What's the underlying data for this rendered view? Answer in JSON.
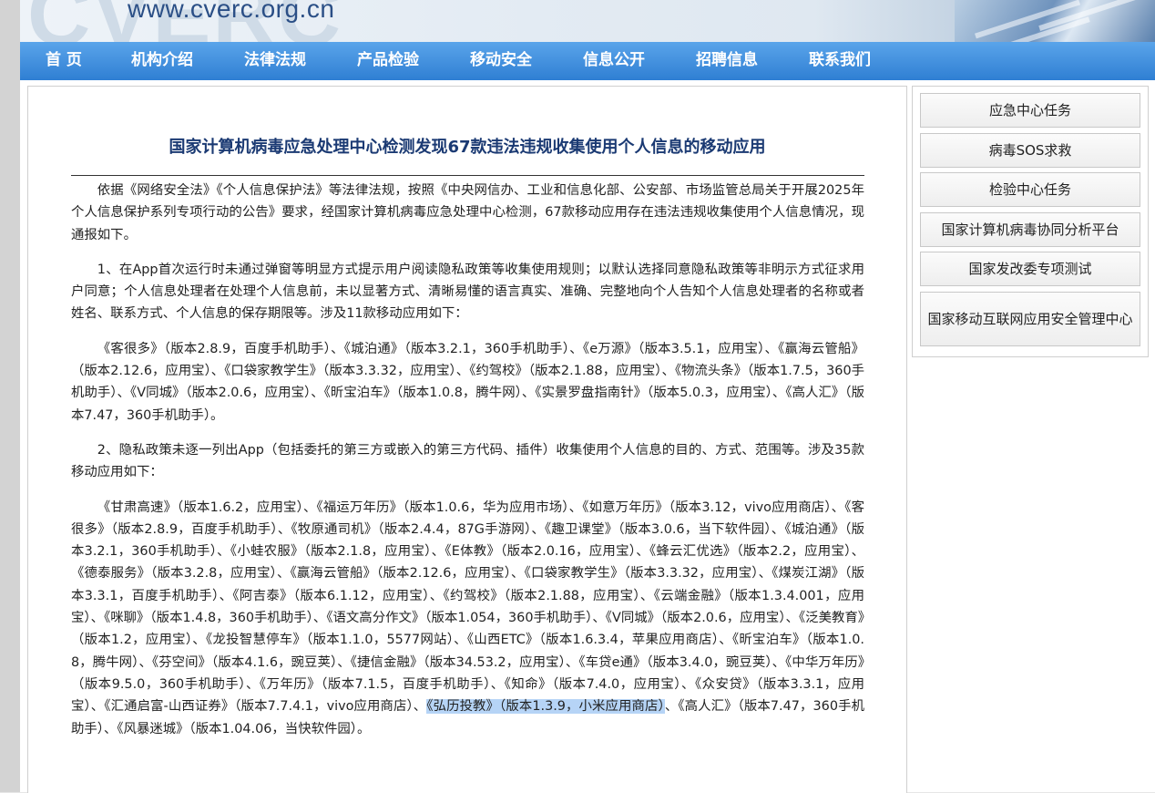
{
  "site": {
    "url": "www.cverc.org.cn",
    "banner_deco": "CVERC"
  },
  "nav": [
    "首 页",
    "机构介绍",
    "法律法规",
    "产品检验",
    "移动安全",
    "信息公开",
    "招聘信息",
    "联系我们"
  ],
  "article": {
    "title": "国家计算机病毒应急处理中心检测发现67款违法违规收集使用个人信息的移动应用",
    "paragraphs": [
      "依据《网络安全法》《个人信息保护法》等法律法规，按照《中央网信办、工业和信息化部、公安部、市场监管总局关于开展2025年个人信息保护系列专项行动的公告》要求，经国家计算机病毒应急处理中心检测，67款移动应用存在违法违规收集使用个人信息情况，现通报如下。",
      "1、在App首次运行时未通过弹窗等明显方式提示用户阅读隐私政策等收集使用规则；以默认选择同意隐私政策等非明示方式征求用户同意；个人信息处理者在处理个人信息前，未以显著方式、清晰易懂的语言真实、准确、完整地向个人告知个人信息处理者的名称或者姓名、联系方式、个人信息的保存期限等。涉及11款移动应用如下：",
      "《客很多》（版本2.8.9，百度手机助手）、《城泊通》（版本3.2.1，360手机助手）、《e万源》（版本3.5.1，应用宝）、《赢海云管船》（版本2.12.6，应用宝）、《口袋家教学生》（版本3.3.32，应用宝）、《约驾校》（版本2.1.88，应用宝）、《物流头条》（版本1.7.5，360手机助手）、《V同城》（版本2.0.6，应用宝）、《昕宝泊车》（版本1.0.8，腾牛网）、《实景罗盘指南针》（版本5.0.3，应用宝）、《高人汇》（版本7.47，360手机助手）。",
      "2、隐私政策未逐一列出App（包括委托的第三方或嵌入的第三方代码、插件）收集使用个人信息的目的、方式、范围等。涉及35款移动应用如下："
    ],
    "p5_before": "《甘肃高速》（版本1.6.2，应用宝）、《福运万年历》（版本1.0.6，华为应用市场）、《如意万年历》（版本3.12，vivo应用商店）、《客很多》（版本2.8.9，百度手机助手）、《牧原通司机》（版本2.4.4，87G手游网）、《趣卫课堂》（版本3.0.6，当下软件园）、《城泊通》（版本3.2.1，360手机助手）、《小蛙农服》（版本2.1.8，应用宝）、《E体教》（版本2.0.16，应用宝）、《蜂云汇优选》（版本2.2，应用宝）、《德泰服务》（版本3.2.8，应用宝）、《赢海云管船》（版本2.12.6，应用宝）、《口袋家教学生》（版本3.3.32，应用宝）、《煤炭江湖》（版本3.3.1，百度手机助手）、《阿吉泰》（版本6.1.12，应用宝）、《约驾校》（版本2.1.88，应用宝）、《云端金融》（版本1.3.4.001，应用宝）、《咪聊》（版本1.4.8，360手机助手）、《语文高分作文》（版本1.054，360手机助手）、《V同城》（版本2.0.6，应用宝）、《泛美教育》（版本1.2，应用宝）、《龙投智慧停车》（版本1.1.0，5577网站）、《山西ETC》（版本1.6.3.4，苹果应用商店）、《昕宝泊车》（版本1.0.8，腾牛网）、《芬空间》（版本4.1.6，豌豆荚）、《捷信金融》（版本34.53.2，应用宝）、《车贷e通》（版本3.4.0，豌豆荚）、《中华万年历》（版本9.5.0，360手机助手）、《万年历》（版本7.1.5，百度手机助手）、《知命》（版本7.4.0，应用宝）、《众安贷》（版本3.3.1，应用宝）、《汇通启富-山西证券》（版本7.7.4.1，vivo应用商店）、",
    "p5_selected": "《弘历投教》（版本1.3.9，小米应用商店）",
    "p5_after": "、《高人汇》（版本7.47，360手机助手）、《风暴迷城》（版本1.04.06，当快软件园）。"
  },
  "sidebar": {
    "items": [
      "应急中心任务",
      "病毒SOS求救",
      "检验中心任务",
      "国家计算机病毒协同分析平台",
      "国家发改委专项测试",
      "国家移动互联网应用安全管理中心"
    ]
  },
  "colors": {
    "nav_top": "#5aa4ea",
    "nav_bottom": "#2f7fd3",
    "title": "#1b3a73",
    "selection": "#b6d4f6"
  }
}
